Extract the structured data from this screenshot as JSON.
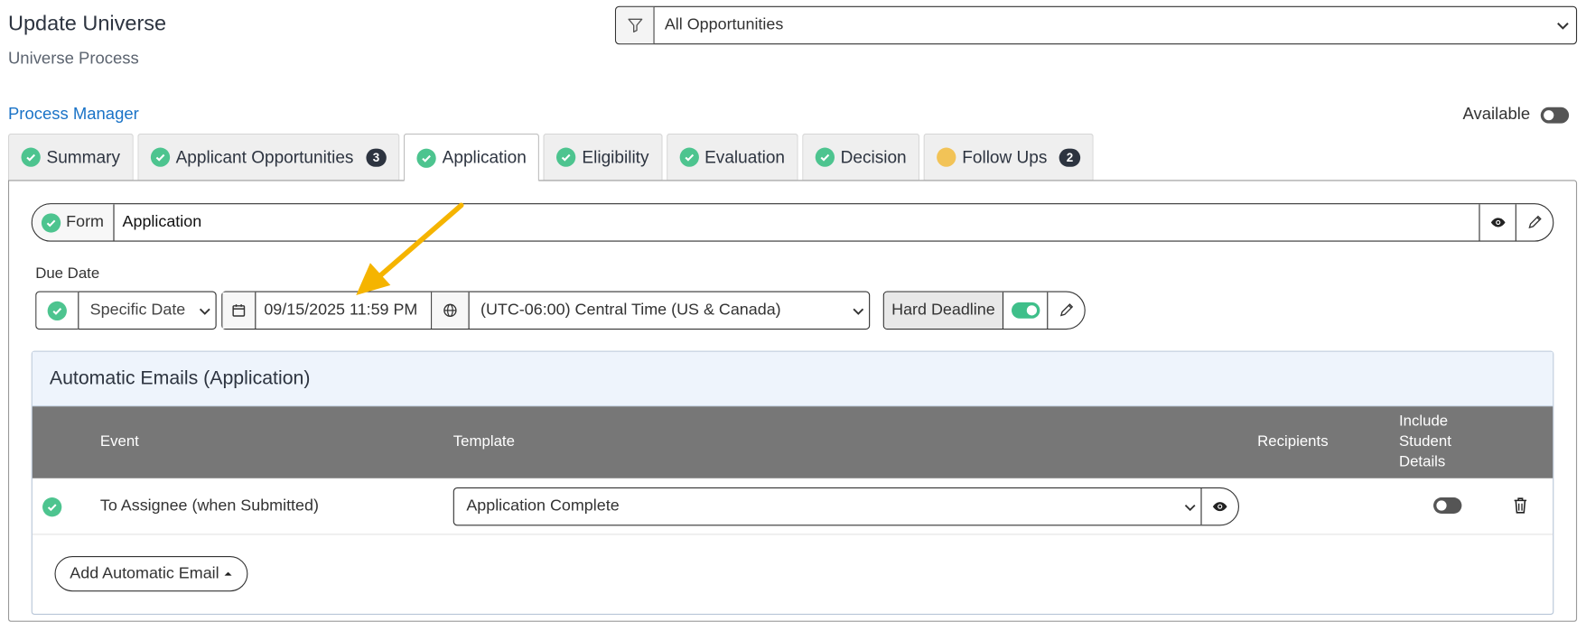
{
  "header": {
    "title": "Update Universe",
    "subtitle": "Universe Process",
    "filter_value": "All Opportunities",
    "process_manager_link": "Process Manager",
    "available_label": "Available"
  },
  "tabs": [
    {
      "label": "Summary",
      "status": "complete"
    },
    {
      "label": "Applicant Opportunities",
      "status": "complete",
      "count": "3"
    },
    {
      "label": "Application",
      "status": "complete",
      "active": true
    },
    {
      "label": "Eligibility",
      "status": "complete"
    },
    {
      "label": "Evaluation",
      "status": "complete"
    },
    {
      "label": "Decision",
      "status": "complete"
    },
    {
      "label": "Follow Ups",
      "status": "pending",
      "count": "2"
    }
  ],
  "form": {
    "label": "Form",
    "value": "Application"
  },
  "due_date": {
    "label": "Due Date",
    "type": "Specific Date",
    "date_value": "09/15/2025 11:59 PM",
    "timezone": "(UTC-06:00) Central Time (US & Canada)",
    "hard_deadline_label": "Hard Deadline",
    "hard_deadline_on": true
  },
  "automatic_emails": {
    "title": "Automatic Emails (Application)",
    "columns": {
      "event": "Event",
      "template": "Template",
      "recipients": "Recipients",
      "include_line1": "Include",
      "include_line2": "Student",
      "include_line3": "Details"
    },
    "rows": [
      {
        "event": "To Assignee (when Submitted)",
        "template": "Application Complete",
        "recipients": "",
        "include_student_details": false
      }
    ],
    "add_button": "Add Automatic Email"
  },
  "colors": {
    "check_green": "#4dc48f",
    "pending_yellow": "#f2c357",
    "link_blue": "#1a73c7",
    "table_header": "#777777",
    "arrow": "#f5b400"
  }
}
